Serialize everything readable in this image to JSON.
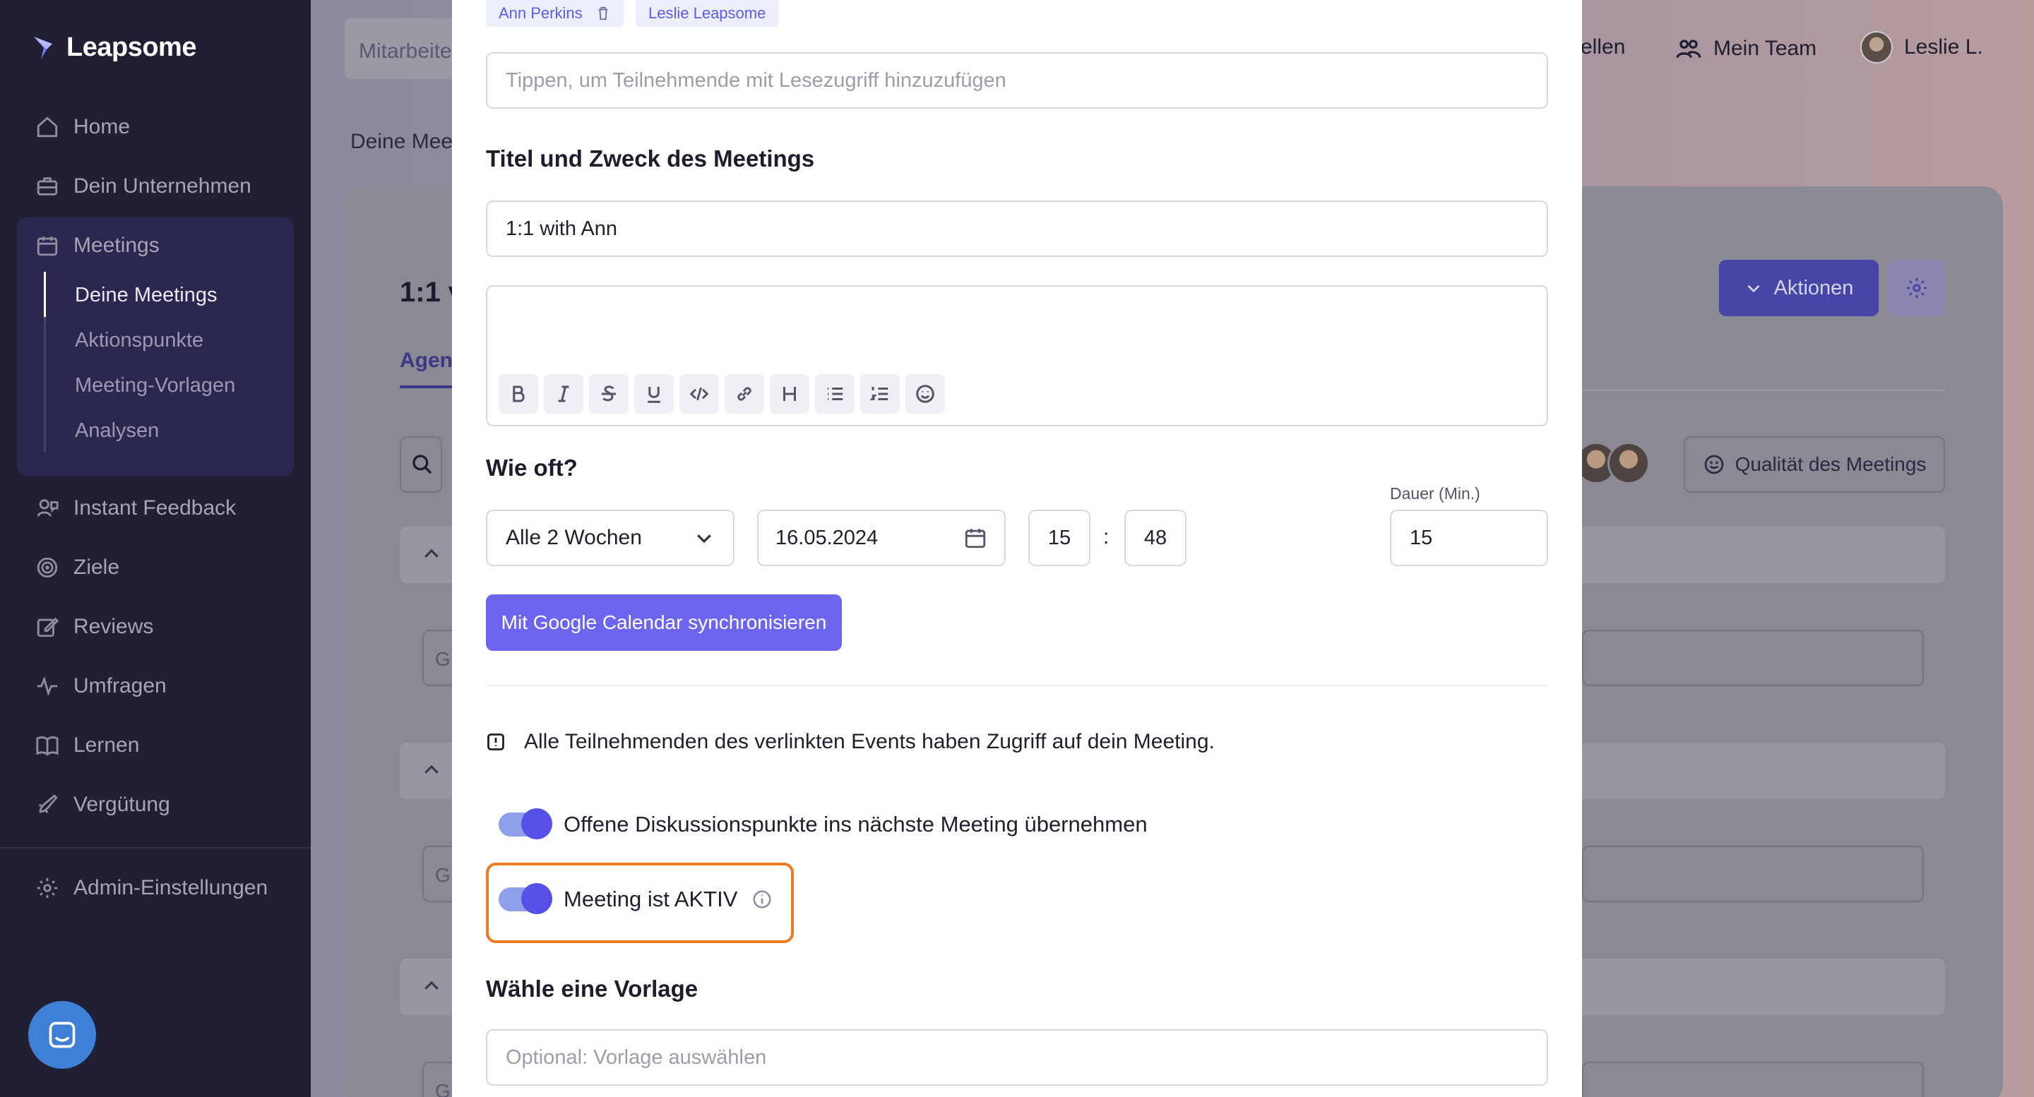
{
  "app": {
    "logo_text": "Leapsome"
  },
  "sidebar": {
    "items": [
      {
        "label": "Home",
        "icon": "home-icon"
      },
      {
        "label": "Dein Unternehmen",
        "icon": "briefcase-icon"
      },
      {
        "label": "Meetings",
        "icon": "calendar-icon"
      },
      {
        "label": "Instant Feedback",
        "icon": "feedback-icon"
      },
      {
        "label": "Ziele",
        "icon": "target-icon"
      },
      {
        "label": "Reviews",
        "icon": "edit-icon"
      },
      {
        "label": "Umfragen",
        "icon": "pulse-icon"
      },
      {
        "label": "Lernen",
        "icon": "book-icon"
      },
      {
        "label": "Vergütung",
        "icon": "rocket-icon"
      },
      {
        "label": "Admin-Einstellungen",
        "icon": "gear-icon"
      }
    ],
    "meetings_sub": [
      "Deine Meetings",
      "Aktionspunkte",
      "Meeting-Vorlagen",
      "Analysen"
    ]
  },
  "background": {
    "search_placeholder": "Mitarbeite",
    "header_partial": "ellen",
    "mein_team": "Mein Team",
    "user_name": "Leslie L.",
    "breadcrumb": "Deine Mee",
    "title_partial": "1:1 v",
    "tab_partial": "Agen",
    "actions_label": "Aktionen",
    "quality_label": "Qualität des Meetings",
    "field_partial": "G"
  },
  "modal": {
    "chips": [
      "Ann Perkins",
      "Leslie Leapsome"
    ],
    "readers_placeholder": "Tippen, um Teilnehmende mit Lesezugriff hinzuzufügen",
    "title_heading": "Titel und Zweck des Meetings",
    "title_value": "1:1 with Ann",
    "frequency_heading": "Wie oft?",
    "frequency_value": "Alle 2 Wochen",
    "date_value": "16.05.2024",
    "hour_value": "15",
    "time_separator": ":",
    "minute_value": "48",
    "duration_label": "Dauer (Min.)",
    "duration_value": "15",
    "sync_button": "Mit Google Calendar synchronisieren",
    "notice_text": "Alle Teilnehmenden des verlinkten Events haben Zugriff auf dein Meeting.",
    "toggle_carry_label": "Offene Diskussionspunkte ins nächste Meeting übernehmen",
    "toggle_active_label": "Meeting ist AKTIV",
    "template_heading": "Wähle eine Vorlage",
    "template_placeholder": "Optional: Vorlage auswählen"
  },
  "colors": {
    "accent": "#6b65f0",
    "highlight": "#f07a22",
    "sidebar": "#211f34"
  }
}
